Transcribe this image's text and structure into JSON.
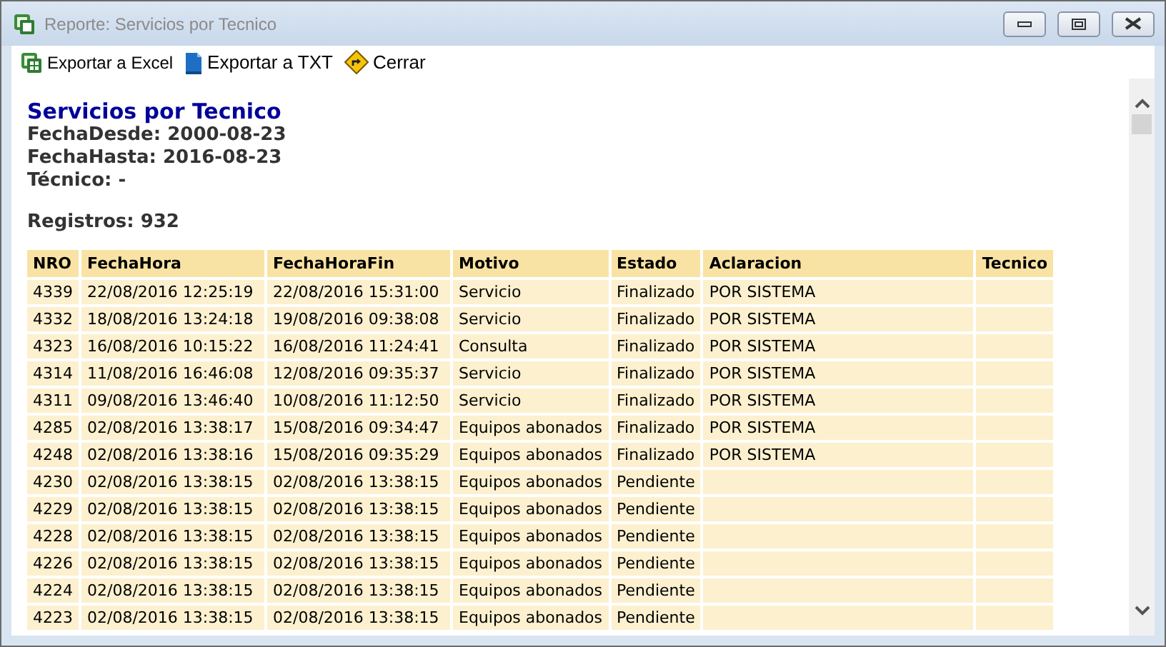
{
  "window": {
    "title": "Reporte: Servicios por Tecnico"
  },
  "toolbar": [
    {
      "kind": "excel",
      "label": "Exportar a Excel"
    },
    {
      "kind": "txt",
      "label": "Exportar a TXT"
    },
    {
      "kind": "close",
      "label": "Cerrar"
    }
  ],
  "report": {
    "title": "Servicios por Tecnico",
    "filters": [
      "FechaDesde: 2000-08-23",
      "FechaHasta: 2016-08-23",
      "Técnico: -"
    ],
    "count": "Registros: 932"
  },
  "table": {
    "columns": [
      "NRO",
      "FechaHora",
      "FechaHoraFin",
      "Motivo",
      "Estado",
      "Aclaracion",
      "Tecnico"
    ],
    "rows": [
      [
        "4339",
        "22/08/2016 12:25:19",
        "22/08/2016 15:31:00",
        "Servicio",
        "Finalizado",
        "POR SISTEMA",
        ""
      ],
      [
        "4332",
        "18/08/2016 13:24:18",
        "19/08/2016 09:38:08",
        "Servicio",
        "Finalizado",
        "POR SISTEMA",
        ""
      ],
      [
        "4323",
        "16/08/2016 10:15:22",
        "16/08/2016 11:24:41",
        "Consulta",
        "Finalizado",
        "POR SISTEMA",
        ""
      ],
      [
        "4314",
        "11/08/2016 16:46:08",
        "12/08/2016 09:35:37",
        "Servicio",
        "Finalizado",
        "POR SISTEMA",
        ""
      ],
      [
        "4311",
        "09/08/2016 13:46:40",
        "10/08/2016 11:12:50",
        "Servicio",
        "Finalizado",
        "POR SISTEMA",
        ""
      ],
      [
        "4285",
        "02/08/2016 13:38:17",
        "15/08/2016 09:34:47",
        "Equipos abonados",
        "Finalizado",
        "POR SISTEMA",
        ""
      ],
      [
        "4248",
        "02/08/2016 13:38:16",
        "15/08/2016 09:35:29",
        "Equipos abonados",
        "Finalizado",
        "POR SISTEMA",
        ""
      ],
      [
        "4230",
        "02/08/2016 13:38:15",
        "02/08/2016 13:38:15",
        "Equipos abonados",
        "Pendiente",
        "",
        ""
      ],
      [
        "4229",
        "02/08/2016 13:38:15",
        "02/08/2016 13:38:15",
        "Equipos abonados",
        "Pendiente",
        "",
        ""
      ],
      [
        "4228",
        "02/08/2016 13:38:15",
        "02/08/2016 13:38:15",
        "Equipos abonados",
        "Pendiente",
        "",
        ""
      ],
      [
        "4226",
        "02/08/2016 13:38:15",
        "02/08/2016 13:38:15",
        "Equipos abonados",
        "Pendiente",
        "",
        ""
      ],
      [
        "4224",
        "02/08/2016 13:38:15",
        "02/08/2016 13:38:15",
        "Equipos abonados",
        "Pendiente",
        "",
        ""
      ],
      [
        "4223",
        "02/08/2016 13:38:15",
        "02/08/2016 13:38:15",
        "Equipos abonados",
        "Pendiente",
        "",
        ""
      ]
    ]
  }
}
